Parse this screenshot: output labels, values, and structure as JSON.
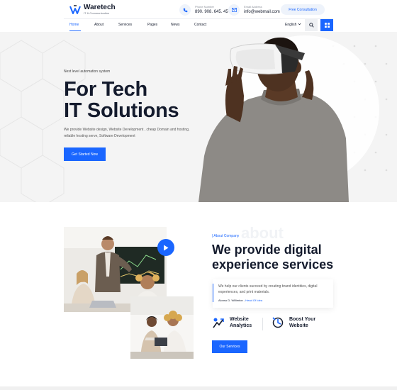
{
  "brand": {
    "name": "Waretech",
    "tagline": "IT & Communication"
  },
  "contact": {
    "phone_label": "Phone Number",
    "phone_value": "890. 908. 645. 45",
    "email_label": "Email Address",
    "email_value": "info@webmail.com"
  },
  "header": {
    "consult_label": "Free Consultation",
    "language": "English"
  },
  "nav": {
    "items": [
      {
        "label": "Home",
        "active": true
      },
      {
        "label": "About"
      },
      {
        "label": "Services"
      },
      {
        "label": "Pages"
      },
      {
        "label": "News"
      },
      {
        "label": "Contact"
      }
    ]
  },
  "hero": {
    "subtitle": "Next level automation system",
    "title_line1": "For Tech",
    "title_line2": "IT Solutions",
    "description": "We provide Website design, Website Development , cheap Domain and hosting, reliable hosting serve, Software Development",
    "cta_label": "Get Started Now"
  },
  "about": {
    "ghost_text": "about",
    "tag": "About Company",
    "title_line1": "We provide digital",
    "title_line2": "experience services",
    "quote": "We help our clients succeed by creating brand identities, digital experiences, and print materials.",
    "author": "Alonso D. Willimton",
    "author_role": "Head Of Idea",
    "features": [
      {
        "line1": "Website",
        "line2": "Analytics",
        "icon": "analytics-icon"
      },
      {
        "line1": "Boost Your",
        "line2": "Website",
        "icon": "boost-icon"
      }
    ],
    "cta_label": "Our Services"
  },
  "colors": {
    "accent": "#1a66ff",
    "dark": "#141b2d",
    "hero_bg": "#f4f4f4"
  }
}
